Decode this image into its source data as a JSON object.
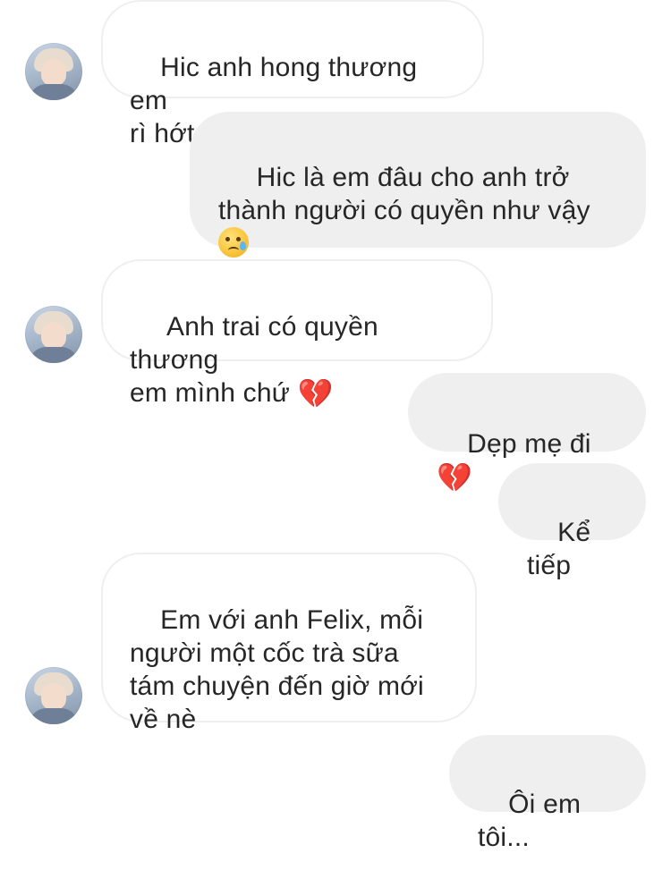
{
  "thread": {
    "messages": [
      {
        "direction": "received",
        "text": "Hic anh hong thương em\nrì hớt ",
        "emoji": "crying-face"
      },
      {
        "direction": "sent",
        "text": " Hic là em đâu cho anh trở\nthành người có quyền như vậy\n",
        "emoji": "crying-face"
      },
      {
        "direction": "received",
        "text": " Anh trai có quyền thương\nem mình chứ ",
        "emoji": "broken-heart"
      },
      {
        "direction": "sent",
        "text": "Dẹp mẹ đi ",
        "emoji": "broken-heart"
      },
      {
        "direction": "sent",
        "text": "Kể tiếp",
        "emoji": ""
      },
      {
        "direction": "received",
        "text": "Em với anh Felix, mỗi\nngười một cốc trà sữa\ntám chuyện đến giờ mới\nvề nè",
        "emoji": ""
      },
      {
        "direction": "sent",
        "text": "Ôi em tôi...",
        "emoji": ""
      }
    ]
  },
  "emoji_glyphs": {
    "broken-heart": "💔"
  },
  "colors": {
    "sent_bubble": "#efefef",
    "received_border": "#efefef",
    "text": "#262626"
  }
}
